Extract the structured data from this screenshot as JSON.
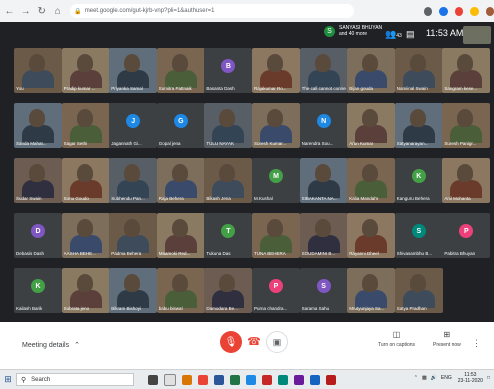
{
  "browser": {
    "url": "meet.google.com/gut-kjrb-vnp?pli=1&authuser=1",
    "lock_icon": "lock-icon"
  },
  "meet_header": {
    "presenter_initial": "S",
    "presenter_name": "SANYASI BHUYAN",
    "presenter_others": "and 40 more",
    "people_count": "43",
    "time": "11:53 AM"
  },
  "participants": [
    {
      "name": "You",
      "type": "photo"
    },
    {
      "name": "Pradip kumar ...",
      "type": "photo"
    },
    {
      "name": "Priyanka Samal",
      "type": "photo"
    },
    {
      "name": "Sumitra Pattnaik",
      "type": "photo"
    },
    {
      "name": "Basanta Dash",
      "type": "avatar",
      "initial": "B",
      "color": "#7e57c2"
    },
    {
      "name": "Rajakumar Ro...",
      "type": "photo"
    },
    {
      "name": "The call cannot connect this",
      "type": "photo"
    },
    {
      "name": "Bijan gouda",
      "type": "photo"
    },
    {
      "name": "Namiinal Swain",
      "type": "photo"
    },
    {
      "name": "Sangram kese...",
      "type": "photo"
    },
    {
      "name": "Sanda Mahat...",
      "type": "photo"
    },
    {
      "name": "Sagar Sethi",
      "type": "photo"
    },
    {
      "name": "Jagannath Gi...",
      "type": "avatar",
      "initial": "J",
      "color": "#1e88e5"
    },
    {
      "name": "Gopal jena",
      "type": "avatar",
      "initial": "G",
      "color": "#1e88e5"
    },
    {
      "name": "TULU NAYAK",
      "type": "photo"
    },
    {
      "name": "Suresh Kumar...",
      "type": "photo"
    },
    {
      "name": "Narendra Sou...",
      "type": "avatar",
      "initial": "N",
      "color": "#1e88e5"
    },
    {
      "name": "Arun Kumar",
      "type": "photo"
    },
    {
      "name": "Satyanarayan...",
      "type": "photo"
    },
    {
      "name": "Suresh Panigr...",
      "type": "photo"
    },
    {
      "name": "Sudar Swain",
      "type": "photo"
    },
    {
      "name": "Sonu Goudo",
      "type": "photo"
    },
    {
      "name": "Subhendu Pan...",
      "type": "photo"
    },
    {
      "name": "Raja Behera",
      "type": "photo"
    },
    {
      "name": "Bikash Jena",
      "type": "photo"
    },
    {
      "name": "M.Kushal",
      "type": "avatar",
      "initial": "M",
      "color": "#43a047"
    },
    {
      "name": "SIBAKANTA NA...",
      "type": "photo"
    },
    {
      "name": "Kalia Mandal's",
      "type": "photo"
    },
    {
      "name": "Kanguru Behera",
      "type": "avatar",
      "initial": "K",
      "color": "#43a047"
    },
    {
      "name": "Anil Mohanta",
      "type": "photo"
    },
    {
      "name": "Debasis Dash",
      "type": "avatar",
      "initial": "D",
      "color": "#7e57c2"
    },
    {
      "name": "AASHA BEHE...",
      "type": "photo"
    },
    {
      "name": "Padma Behera",
      "type": "photo"
    },
    {
      "name": "Maamoki Red...",
      "type": "photo"
    },
    {
      "name": "Tukuna Das",
      "type": "avatar",
      "initial": "T",
      "color": "#43a047"
    },
    {
      "name": "TUNA BEHERA",
      "type": "photo"
    },
    {
      "name": "SOUDAMINI B...",
      "type": "photo"
    },
    {
      "name": "Rayanni Dheel",
      "type": "photo"
    },
    {
      "name": "Shivasambhu B...",
      "type": "avatar",
      "initial": "S",
      "color": "#00897b"
    },
    {
      "name": "Pabitra Bhuyan",
      "type": "avatar",
      "initial": "P",
      "color": "#ec407a"
    },
    {
      "name": "Kailash Barik",
      "type": "avatar",
      "initial": "K",
      "color": "#43a047"
    },
    {
      "name": "Subrata jeno",
      "type": "photo"
    },
    {
      "name": "Bikram Bishoyi",
      "type": "photo"
    },
    {
      "name": "babu biswal",
      "type": "photo"
    },
    {
      "name": "Damodara Be...",
      "type": "photo"
    },
    {
      "name": "Purna chandra...",
      "type": "avatar",
      "initial": "P",
      "color": "#ec407a"
    },
    {
      "name": "Sarama Sahu",
      "type": "avatar",
      "initial": "S",
      "color": "#7e57c2"
    },
    {
      "name": "Mrutyunjaya Sa...",
      "type": "photo"
    },
    {
      "name": "Satya Pradhan",
      "type": "photo"
    }
  ],
  "controls": {
    "meeting_details": "Meeting details",
    "captions_label": "Turn on captions",
    "present_label": "Present now"
  },
  "taskbar": {
    "search_placeholder": "Search",
    "lang": "ENG",
    "time": "11:53",
    "date": "23-11-2020"
  }
}
